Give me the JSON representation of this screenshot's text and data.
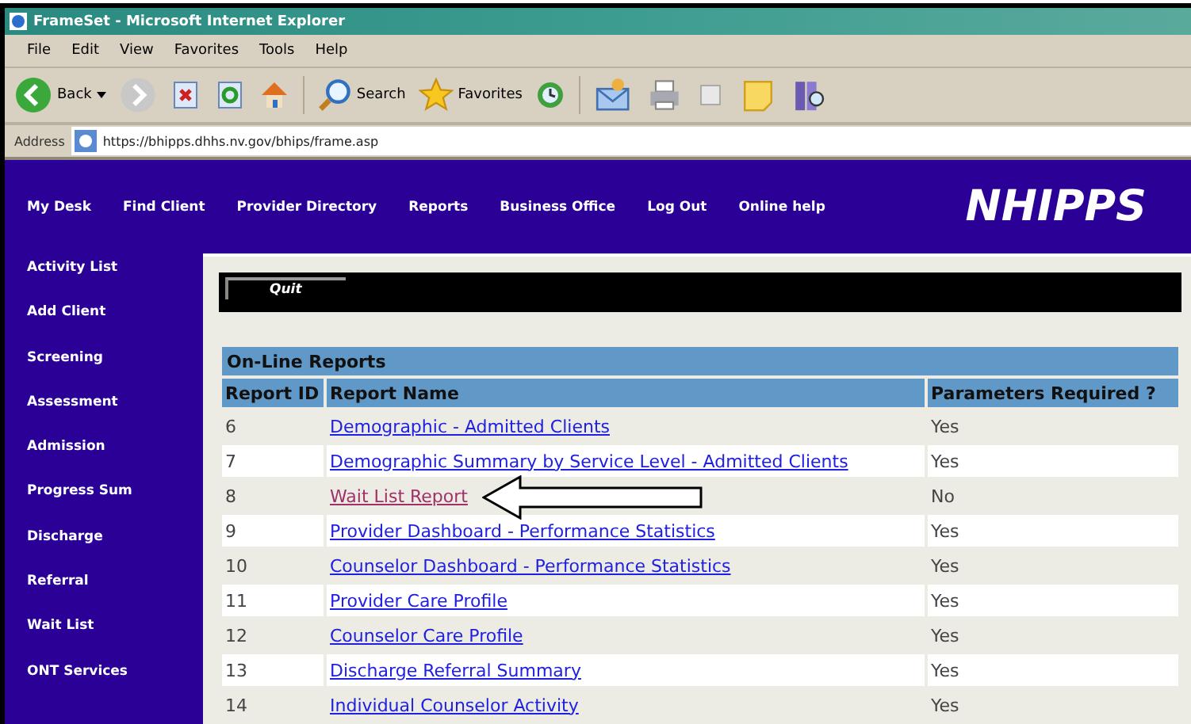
{
  "window": {
    "title": "FrameSet - Microsoft Internet Explorer"
  },
  "menu": [
    "File",
    "Edit",
    "View",
    "Favorites",
    "Tools",
    "Help"
  ],
  "toolbar": {
    "back": "Back",
    "search": "Search",
    "favorites": "Favorites"
  },
  "address": {
    "label": "Address",
    "value": "https://bhipps.dhhs.nv.gov/bhips/frame.asp"
  },
  "top_nav": [
    "My Desk",
    "Find Client",
    "Provider Directory",
    "Reports",
    "Business Office",
    "Log Out",
    "Online help"
  ],
  "logo": "NHIPPS",
  "sidebar": [
    "Activity List",
    "Add Client",
    "Screening",
    "Assessment",
    "Admission",
    "Progress Sum",
    "Discharge",
    "Referral",
    "Wait List",
    "ONT Services"
  ],
  "quit": "Quit",
  "table": {
    "title": "On-Line Reports",
    "columns": [
      "Report ID",
      "Report Name",
      "Parameters Required ?"
    ],
    "rows": [
      {
        "id": "6",
        "name": "Demographic - Admitted Clients",
        "params": "Yes",
        "visited": false
      },
      {
        "id": "7",
        "name": "Demographic Summary by Service Level - Admitted Clients",
        "params": "Yes",
        "visited": false
      },
      {
        "id": "8",
        "name": "Wait List Report",
        "params": "No",
        "visited": true
      },
      {
        "id": "9",
        "name": "Provider Dashboard - Performance Statistics",
        "params": "Yes",
        "visited": false
      },
      {
        "id": "10",
        "name": "Counselor Dashboard - Performance Statistics",
        "params": "Yes",
        "visited": false
      },
      {
        "id": "11",
        "name": "Provider Care Profile",
        "params": "Yes",
        "visited": false
      },
      {
        "id": "12",
        "name": "Counselor Care Profile",
        "params": "Yes",
        "visited": false
      },
      {
        "id": "13",
        "name": "Discharge Referral Summary",
        "params": "Yes",
        "visited": false
      },
      {
        "id": "14",
        "name": "Individual Counselor Activity",
        "params": "Yes",
        "visited": false
      }
    ]
  }
}
